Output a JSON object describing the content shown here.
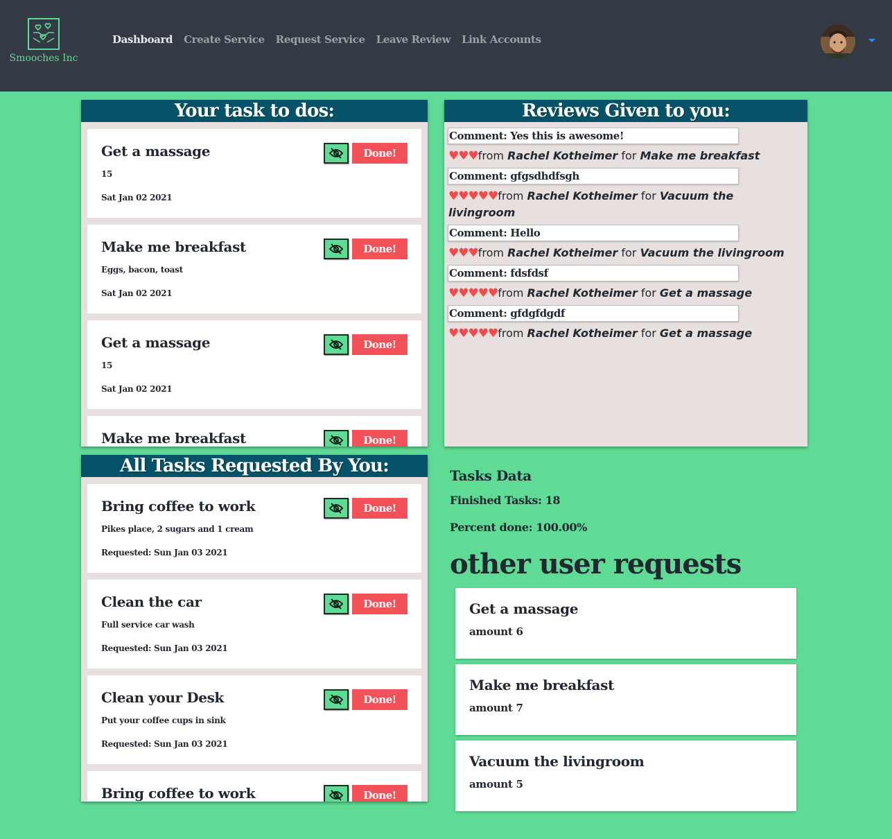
{
  "app": {
    "brand": "Smooches Inc",
    "nav": [
      {
        "label": "Dashboard",
        "active": true
      },
      {
        "label": "Create Service",
        "active": false
      },
      {
        "label": "Request Service",
        "active": false
      },
      {
        "label": "Leave Review",
        "active": false
      },
      {
        "label": "Link Accounts",
        "active": false
      }
    ]
  },
  "colors": {
    "background": "#5fdb95",
    "navbar": "#343a44",
    "panel_header": "#065268",
    "done_button": "#f25257",
    "heart": "#f24b4b"
  },
  "todos": {
    "title": "Your task to dos:",
    "done_label": "Done!",
    "items": [
      {
        "title": "Get a massage",
        "desc": "15",
        "date": "Sat Jan 02 2021"
      },
      {
        "title": "Make me breakfast",
        "desc": "Eggs, bacon, toast",
        "date": "Sat Jan 02 2021"
      },
      {
        "title": "Get a massage",
        "desc": "15",
        "date": "Sat Jan 02 2021"
      },
      {
        "title": "Make me breakfast",
        "desc": "",
        "date": ""
      }
    ]
  },
  "reviews": {
    "title": "Reviews Given to you:",
    "items": [
      {
        "comment": "Comment: Yes this is awesome!",
        "hearts": "♥♥♥",
        "from_word": "from",
        "author": "Rachel Kotheimer",
        "for_word": "for",
        "task": "Make me breakfast"
      },
      {
        "comment": "Comment: gfgsdhdfsgh",
        "hearts": "♥♥♥♥♥",
        "from_word": "from",
        "author": "Rachel Kotheimer",
        "for_word": "for",
        "task": "Vacuum the livingroom"
      },
      {
        "comment": "Comment: Hello",
        "hearts": "♥♥♥",
        "from_word": "from",
        "author": "Rachel Kotheimer",
        "for_word": "for",
        "task": "Vacuum the livingroom"
      },
      {
        "comment": "Comment: fdsfdsf",
        "hearts": "♥♥♥♥♥",
        "from_word": "from",
        "author": "Rachel Kotheimer",
        "for_word": "for",
        "task": "Get a massage"
      },
      {
        "comment": "Comment: gfdgfdgdf",
        "hearts": "♥♥♥♥♥",
        "from_word": "from",
        "author": "Rachel Kotheimer",
        "for_word": "for",
        "task": "Get a massage"
      }
    ]
  },
  "requested": {
    "title": "All Tasks Requested By You:",
    "done_label": "Done!",
    "items": [
      {
        "title": "Bring coffee to work",
        "desc": "Pikes place, 2 sugars and 1 cream",
        "date": "Requested: Sun Jan 03 2021"
      },
      {
        "title": "Clean the car",
        "desc": "Full service car wash",
        "date": "Requested: Sun Jan 03 2021"
      },
      {
        "title": "Clean your Desk",
        "desc": "Put your coffee cups in sink",
        "date": "Requested: Sun Jan 03 2021"
      },
      {
        "title": "Bring coffee to work",
        "desc": "",
        "date": ""
      }
    ]
  },
  "stats": {
    "title": "Tasks Data",
    "finished": "Finished Tasks: 18",
    "percent": "Percent done: 100.00%"
  },
  "other_requests": {
    "title": "other user requests",
    "items": [
      {
        "name": "Get a massage",
        "amount": "amount 6"
      },
      {
        "name": "Make me breakfast",
        "amount": "amount 7"
      },
      {
        "name": "Vacuum the livingroom",
        "amount": "amount 5"
      }
    ]
  }
}
